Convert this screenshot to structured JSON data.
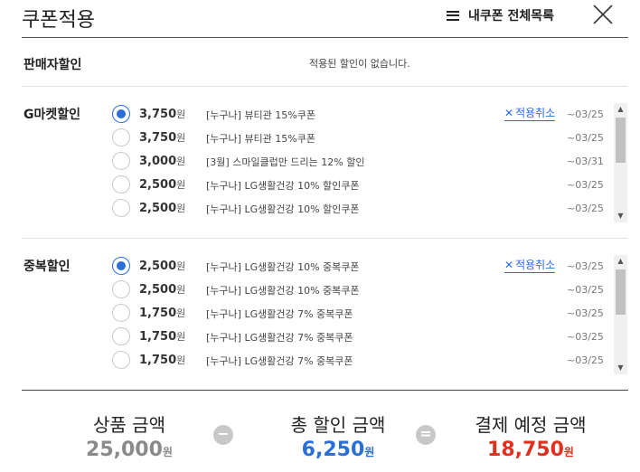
{
  "header": {
    "title": "쿠폰적용",
    "my_coupons_label": "내쿠폰 전체목록",
    "menu_icon": "menu-icon",
    "close_icon": "close-icon"
  },
  "seller_discount": {
    "label": "판매자할인",
    "message": "적용된 할인이 없습니다."
  },
  "gmarket_discount": {
    "label": "G마켓할인",
    "coupons": [
      {
        "amount": "3,750",
        "unit": "원",
        "name": "[누구나] 뷰티관 15%쿠폰",
        "date": "~03/25",
        "selected": true,
        "cancel_label": "적용취소"
      },
      {
        "amount": "3,750",
        "unit": "원",
        "name": "[누구나] 뷰티관 15%쿠폰",
        "date": "~03/25",
        "selected": false
      },
      {
        "amount": "3,000",
        "unit": "원",
        "name": "[3월] 스마일클럽만 드리는 12% 할인",
        "date": "~03/31",
        "selected": false
      },
      {
        "amount": "2,500",
        "unit": "원",
        "name": "[누구나] LG생활건강 10% 할인쿠폰",
        "date": "~03/25",
        "selected": false
      },
      {
        "amount": "2,500",
        "unit": "원",
        "name": "[누구나] LG생활건강 10% 할인쿠폰",
        "date": "~03/25",
        "selected": false
      }
    ]
  },
  "duplicate_discount": {
    "label": "중복할인",
    "coupons": [
      {
        "amount": "2,500",
        "unit": "원",
        "name": "[누구나] LG생활건강 10% 중복쿠폰",
        "date": "~03/25",
        "selected": true,
        "cancel_label": "적용취소"
      },
      {
        "amount": "2,500",
        "unit": "원",
        "name": "[누구나] LG생활건강 10% 중복쿠폰",
        "date": "~03/25",
        "selected": false
      },
      {
        "amount": "1,750",
        "unit": "원",
        "name": "[누구나] LG생활건강 7% 중복쿠폰",
        "date": "~03/25",
        "selected": false
      },
      {
        "amount": "1,750",
        "unit": "원",
        "name": "[누구나] LG생활건강 7% 중복쿠폰",
        "date": "~03/25",
        "selected": false
      },
      {
        "amount": "1,750",
        "unit": "원",
        "name": "[누구나] LG생활건강 7% 중복쿠폰",
        "date": "~03/25",
        "selected": false
      }
    ]
  },
  "totals": {
    "product_label": "상품 금액",
    "product_value": "25,000",
    "discount_label": "총 할인 금액",
    "discount_value": "6,250",
    "payment_label": "결제 예정 금액",
    "payment_value": "18,750",
    "unit": "원",
    "minus_symbol": "−",
    "equals_symbol": "="
  },
  "colors": {
    "accent": "#2a6ed8",
    "total_red": "#e0301e",
    "total_gray": "#8a8a8a"
  }
}
